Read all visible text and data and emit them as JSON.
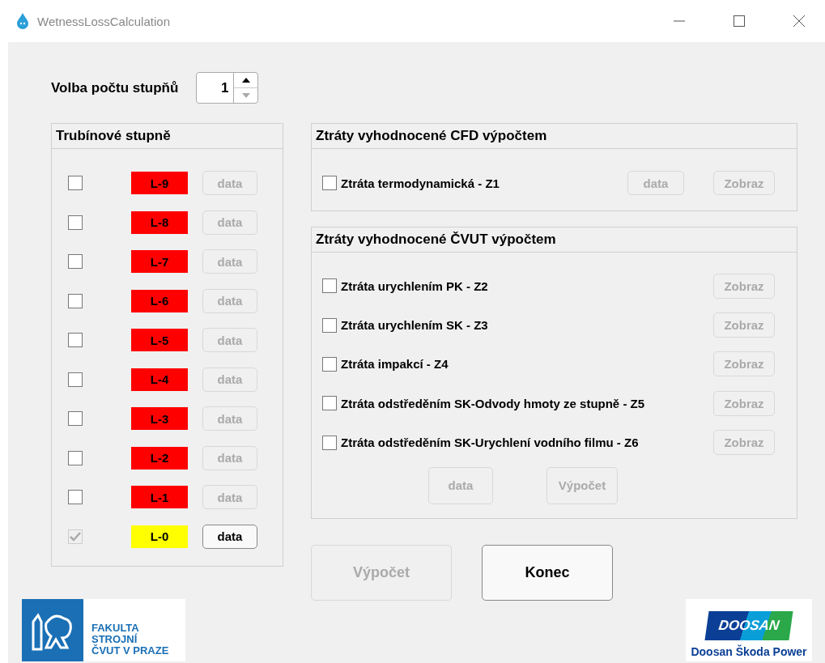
{
  "window": {
    "title": "WetnessLossCalculation"
  },
  "stage_count": {
    "label": "Volba počtu stupňů",
    "value": "1"
  },
  "stages_panel": {
    "title": "Trubínové stupně",
    "stages": [
      {
        "checked": false,
        "check_disabled": false,
        "label": "L-9",
        "color": "#ff0000",
        "data_button": "data",
        "data_disabled": true
      },
      {
        "checked": false,
        "check_disabled": false,
        "label": "L-8",
        "color": "#ff0000",
        "data_button": "data",
        "data_disabled": true
      },
      {
        "checked": false,
        "check_disabled": false,
        "label": "L-7",
        "color": "#ff0000",
        "data_button": "data",
        "data_disabled": true
      },
      {
        "checked": false,
        "check_disabled": false,
        "label": "L-6",
        "color": "#ff0000",
        "data_button": "data",
        "data_disabled": true
      },
      {
        "checked": false,
        "check_disabled": false,
        "label": "L-5",
        "color": "#ff0000",
        "data_button": "data",
        "data_disabled": true
      },
      {
        "checked": false,
        "check_disabled": false,
        "label": "L-4",
        "color": "#ff0000",
        "data_button": "data",
        "data_disabled": true
      },
      {
        "checked": false,
        "check_disabled": false,
        "label": "L-3",
        "color": "#ff0000",
        "data_button": "data",
        "data_disabled": true
      },
      {
        "checked": false,
        "check_disabled": false,
        "label": "L-2",
        "color": "#ff0000",
        "data_button": "data",
        "data_disabled": true
      },
      {
        "checked": false,
        "check_disabled": false,
        "label": "L-1",
        "color": "#ff0000",
        "data_button": "data",
        "data_disabled": true
      },
      {
        "checked": true,
        "check_disabled": true,
        "label": "L-0",
        "color": "#ffff00",
        "data_button": "data",
        "data_disabled": false
      }
    ]
  },
  "cfd_panel": {
    "title": "Ztráty vyhodnocené CFD výpočtem",
    "items": [
      {
        "label": "Ztráta termodynamická - Z1",
        "checked": false,
        "data_button": "data",
        "data_disabled": true,
        "show_button": "Zobraz",
        "show_disabled": true
      }
    ]
  },
  "cvut_panel": {
    "title": "Ztráty vyhodnocené ČVUT výpočtem",
    "items": [
      {
        "label": "Ztráta urychlením PK - Z2",
        "checked": false,
        "show_button": "Zobraz",
        "show_disabled": true
      },
      {
        "label": "Ztráta urychlením SK - Z3",
        "checked": false,
        "show_button": "Zobraz",
        "show_disabled": true
      },
      {
        "label": "Ztráta impakcí - Z4",
        "checked": false,
        "show_button": "Zobraz",
        "show_disabled": true
      },
      {
        "label": "Ztráta odstředěním SK-Odvody hmoty ze stupně - Z5",
        "checked": false,
        "show_button": "Zobraz",
        "show_disabled": true
      },
      {
        "label": "Ztráta odstředěním SK-Urychlení vodního filmu - Z6",
        "checked": false,
        "show_button": "Zobraz",
        "show_disabled": true
      }
    ],
    "buttons": [
      {
        "label": "data",
        "disabled": true
      },
      {
        "label": "Výpočet",
        "disabled": true
      }
    ]
  },
  "main_buttons": [
    {
      "label": "Výpočet",
      "disabled": true
    },
    {
      "label": "Konec",
      "disabled": false
    }
  ],
  "logos": {
    "left_lines": [
      "FAKULTA",
      "STROJNÍ",
      "ČVUT V PRAZE"
    ],
    "right_mark": "DOOSAN",
    "right_caption": "Doosan Škoda Power"
  }
}
